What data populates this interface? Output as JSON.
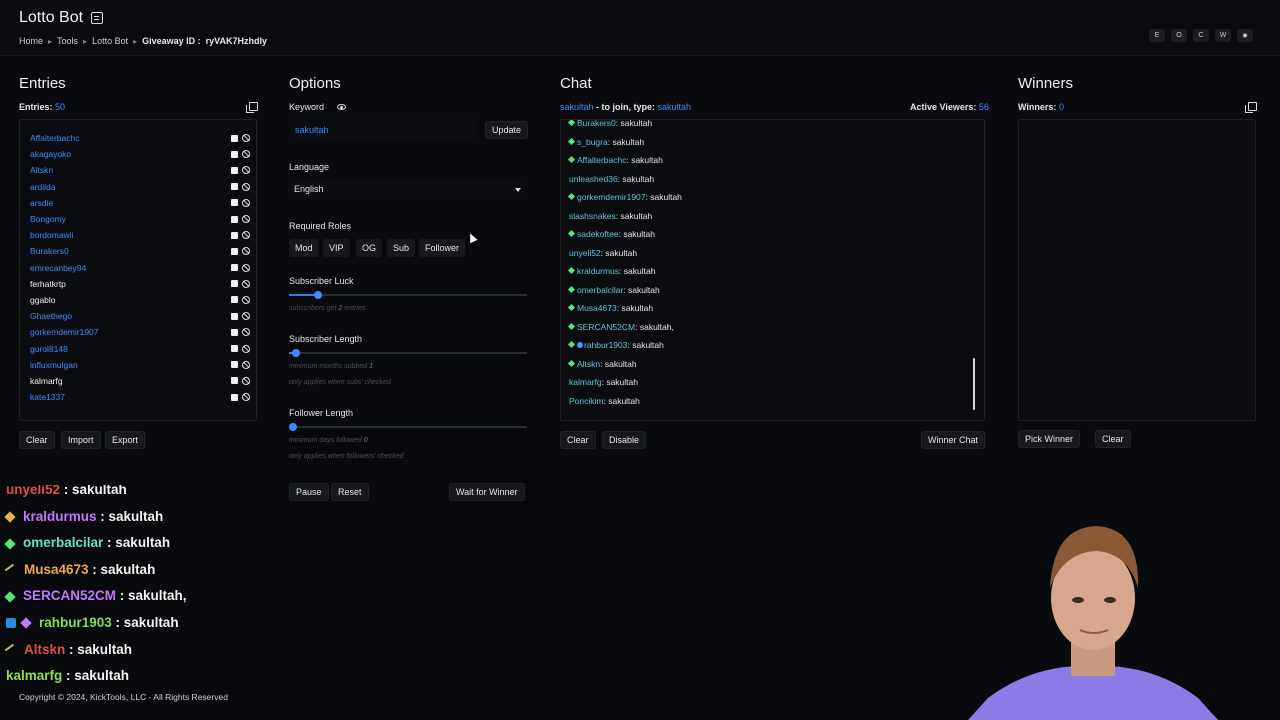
{
  "header": {
    "app_title": "Lotto Bot",
    "breadcrumb": [
      "Home",
      "Tools",
      "Lotto Bot"
    ],
    "giveaway_label": "Giveaway ID :",
    "giveaway_id": "ryVAK7Hzhdly",
    "top_buttons": [
      "E",
      "O",
      "C",
      "W",
      "✹"
    ]
  },
  "entries": {
    "title": "Entries",
    "count_label": "Entries:",
    "count": "50",
    "items": [
      {
        "name": "Affalterbachc",
        "color": "blue"
      },
      {
        "name": "akagayoko",
        "color": "blue"
      },
      {
        "name": "Altskn",
        "color": "blue"
      },
      {
        "name": "ardilda",
        "color": "blue"
      },
      {
        "name": "arsdie",
        "color": "blue"
      },
      {
        "name": "Bongomy",
        "color": "blue"
      },
      {
        "name": "bordomawii",
        "color": "blue"
      },
      {
        "name": "Burakers0",
        "color": "blue"
      },
      {
        "name": "emrecanbey94",
        "color": "blue"
      },
      {
        "name": "ferhatkrtp",
        "color": "white"
      },
      {
        "name": "ggablo",
        "color": "white"
      },
      {
        "name": "Ghaethego",
        "color": "blue"
      },
      {
        "name": "gorkemdemir1907",
        "color": "blue"
      },
      {
        "name": "gurol8148",
        "color": "blue"
      },
      {
        "name": "influxmulgan",
        "color": "blue"
      },
      {
        "name": "kalmarfg",
        "color": "white"
      },
      {
        "name": "kate1337",
        "color": "blue"
      }
    ],
    "buttons": {
      "clear": "Clear",
      "import": "Import",
      "export": "Export"
    }
  },
  "options": {
    "title": "Options",
    "keyword_label": "Keyword",
    "keyword_value": "sakultah",
    "update_button": "Update",
    "language_label": "Language",
    "language_value": "English",
    "required_roles_label": "Required Roles",
    "roles": [
      "Mod",
      "VIP",
      "OG",
      "Sub",
      "Follower"
    ],
    "subscriber_luck": {
      "label": "Subscriber Luck",
      "hint_pre": "subscribers get",
      "hint_num": "2",
      "hint_post": "entries",
      "value_fraction": 0.12
    },
    "subscriber_length": {
      "label": "Subscriber Length",
      "hint_pre": "minimum months subbed",
      "hint_num": "1",
      "hint2": "only applies when subs' checked",
      "value_fraction": 0.03
    },
    "follower_length": {
      "label": "Follower Length",
      "hint_pre": "minimum days followed",
      "hint_num": "0",
      "hint2": "only applies when followers' checked",
      "value_fraction": 0.0
    },
    "buttons": {
      "pause": "Pause",
      "reset": "Reset",
      "wait": "Wait for Winner"
    }
  },
  "chat": {
    "title": "Chat",
    "join_user": "sakultah",
    "join_text": " - to join, type: ",
    "join_keyword": "sakultah",
    "viewers_label": "Active Viewers:",
    "viewers": "56",
    "messages": [
      {
        "user": "Burakers0",
        "msg": "sakultah",
        "badge": "gem"
      },
      {
        "user": "s_bugra",
        "msg": "sakultah",
        "badge": "gem"
      },
      {
        "user": "Affalterbachc",
        "msg": "sakultah",
        "badge": "gem"
      },
      {
        "user": "unleashed36",
        "msg": "sakultah",
        "badge": ""
      },
      {
        "user": "gorkemdemir1907",
        "msg": "sakultah",
        "badge": "gem"
      },
      {
        "user": "slashsnakes",
        "msg": "sakultah",
        "badge": ""
      },
      {
        "user": "sadekoftee",
        "msg": "sakultah",
        "badge": "gem"
      },
      {
        "user": "unyeli52",
        "msg": "sakultah",
        "badge": ""
      },
      {
        "user": "kraldurmus",
        "msg": "sakultah",
        "badge": "gem"
      },
      {
        "user": "omerbalcilar",
        "msg": "sakultah",
        "badge": "gem"
      },
      {
        "user": "Musa4673",
        "msg": "sakultah",
        "badge": "gem"
      },
      {
        "user": "SERCAN52CM",
        "msg": "sakultah,",
        "badge": "gem"
      },
      {
        "user": "rahbur1903",
        "msg": "sakultah",
        "badge": "orb"
      },
      {
        "user": "Altskn",
        "msg": "sakultah",
        "badge": "gem"
      },
      {
        "user": "kalmarfg",
        "msg": "sakultah",
        "badge": ""
      },
      {
        "user": "Poncikim",
        "msg": "sakultah",
        "badge": ""
      }
    ],
    "buttons": {
      "clear": "Clear",
      "disable": "Disable",
      "winner_chat": "Winner Chat"
    }
  },
  "winners": {
    "title": "Winners",
    "count_label": "Winners:",
    "count": "0",
    "buttons": {
      "pick": "Pick Winner",
      "clear": "Clear"
    }
  },
  "overlay_chat": [
    {
      "user": "unyeli52",
      "msg": " : sakultah",
      "color": "#e0504a",
      "badge": "none"
    },
    {
      "user": "kraldurmus",
      "msg": " : sakultah",
      "color": "#c678ff",
      "badge": "gold"
    },
    {
      "user": "omerbalcilar",
      "msg": " : sakultah",
      "color": "#6fe0c0",
      "badge": "gem"
    },
    {
      "user": "Musa4673",
      "msg": " : sakultah",
      "color": "#f0a74a",
      "badge": "sword"
    },
    {
      "user": "SERCAN52CM",
      "msg": " : sakultah,",
      "color": "#c678ff",
      "badge": "gem"
    },
    {
      "user": "rahbur1903",
      "msg": " : sakultah",
      "color": "#7be05b",
      "badge": "cube"
    },
    {
      "user": "Altskn",
      "msg": " : sakultah",
      "color": "#e0504a",
      "badge": "sword"
    },
    {
      "user": "kalmarfg",
      "msg": " : sakultah",
      "color": "#8ee05b",
      "badge": "none"
    }
  ],
  "footer": {
    "copyright": "Copyright © 2024, KickTools, LLC - All Rights Reserved"
  },
  "colors": {
    "accent": "#3d8bff",
    "background": "#08090c",
    "gem_green": "#5be07a"
  }
}
